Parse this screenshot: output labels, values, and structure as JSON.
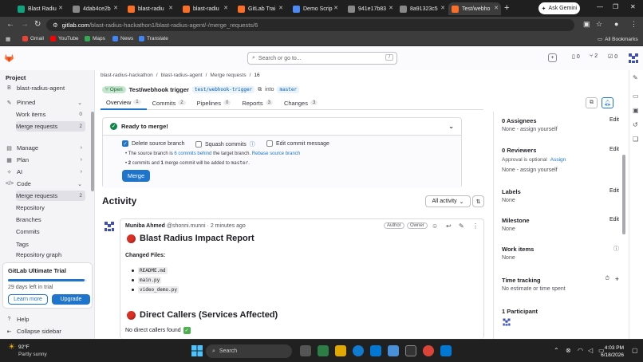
{
  "browser": {
    "tabs": [
      {
        "label": "Blast Radiu",
        "color": "#10a37f"
      },
      {
        "label": "4dab4ce2b",
        "color": "#888888"
      },
      {
        "label": "blast-radiu",
        "color": "#fc6d26"
      },
      {
        "label": "blast-radiu",
        "color": "#fc6d26"
      },
      {
        "label": "GitLab Trai",
        "color": "#fc6d26"
      },
      {
        "label": "Demo Scrip",
        "color": "#4c8bf5"
      },
      {
        "label": "941e17b83",
        "color": "#888888"
      },
      {
        "label": "8a91323c5",
        "color": "#888888"
      },
      {
        "label": "Test/webho",
        "color": "#fc6d26"
      }
    ],
    "ask_gemini": "Ask Gemini",
    "url_host": "gitlab.com",
    "url_path": "/blast-radius-hackathon1/blast-radius-agent/-/merge_requests/6",
    "bookmarks": [
      "Gmail",
      "YouTube",
      "Maps",
      "News",
      "Translate"
    ],
    "all_bookmarks": "All Bookmarks"
  },
  "topbar": {
    "search_placeholder": "Search or go to...",
    "slash": "/",
    "counts": {
      "issues": "0",
      "mrs": "2",
      "todos": "0"
    },
    "plus": "+"
  },
  "sidebar": {
    "section": "Project",
    "project": "blast-radius-agent",
    "project_initial": "B",
    "pinned": "Pinned",
    "pinned_items": [
      {
        "label": "Work items",
        "count": "0"
      },
      {
        "label": "Merge requests",
        "count": "2"
      }
    ],
    "groups": [
      "Manage",
      "Plan",
      "AI",
      "Code"
    ],
    "code_items": [
      {
        "label": "Merge requests",
        "count": "2"
      },
      {
        "label": "Repository",
        "count": ""
      },
      {
        "label": "Branches",
        "count": ""
      },
      {
        "label": "Commits",
        "count": ""
      },
      {
        "label": "Tags",
        "count": ""
      },
      {
        "label": "Repository graph",
        "count": ""
      }
    ],
    "trial": {
      "title": "GitLab Ultimate Trial",
      "days": "29 days left in trial",
      "learn": "Learn more",
      "upgrade": "Upgrade",
      "progress": 0.97
    },
    "help": "Help",
    "collapse": "Collapse sidebar"
  },
  "breadcrumb": [
    "blast-radius-hackathon",
    "blast-radius-agent",
    "Merge requests",
    "16"
  ],
  "mr": {
    "status": "Open",
    "title": "Test/webhook trigger",
    "source_branch": "test/webhook-trigger",
    "into": "into",
    "target_branch": "master",
    "tabs": [
      {
        "label": "Overview",
        "count": "1"
      },
      {
        "label": "Commits",
        "count": "2"
      },
      {
        "label": "Pipelines",
        "count": "0"
      },
      {
        "label": "Reports",
        "count": "3"
      },
      {
        "label": "Changes",
        "count": "3"
      }
    ]
  },
  "merge_widget": {
    "title": "Ready to merge!",
    "options": [
      {
        "label": "Delete source branch",
        "checked": true
      },
      {
        "label": "Squash commits",
        "checked": false
      },
      {
        "label": "Edit commit message",
        "checked": false
      }
    ],
    "line1_a": "The source branch is",
    "line1_link": "6 commits behind",
    "line1_b": "the target branch.",
    "line1_link2": "Rebase source branch",
    "line2_a": "2",
    "line2_b": "commits and",
    "line2_c": "1",
    "line2_d": "merge commit will be added to",
    "line2_e": "master",
    "merge_button": "Merge"
  },
  "activity": {
    "title": "Activity",
    "filter": "All activity",
    "note": {
      "author": "Muniba Ahmed",
      "handle": "@shonni.munni",
      "time": "2 minutes ago",
      "roles": [
        "Author",
        "Owner"
      ],
      "heading": "Blast Radius Impact Report",
      "changed_files_label": "Changed Files:",
      "files": [
        "README.md",
        "main.py",
        "video_demo.py"
      ],
      "heading2": "Direct Callers (Services Affected)",
      "no_callers": "No direct callers found"
    }
  },
  "right_sidebar": {
    "assignees": {
      "label": "0 Assignees",
      "edit": "Edit",
      "value": "None - assign yourself"
    },
    "reviewers": {
      "label": "0 Reviewers",
      "edit": "Edit",
      "note": "Approval is optional",
      "assign": "Assign",
      "value": "None - assign yourself"
    },
    "labels": {
      "label": "Labels",
      "edit": "Edit",
      "value": "None"
    },
    "milestone": {
      "label": "Milestone",
      "edit": "Edit",
      "value": "None"
    },
    "work_items": {
      "label": "Work items",
      "value": "None"
    },
    "time_tracking": {
      "label": "Time tracking",
      "value": "No estimate or time spent"
    },
    "participants": {
      "label": "1 Participant"
    }
  },
  "taskbar": {
    "temp": "92°F",
    "weather": "Partly sunny",
    "search": "Search",
    "time": "4:03 PM",
    "date": "6/18/2026"
  }
}
